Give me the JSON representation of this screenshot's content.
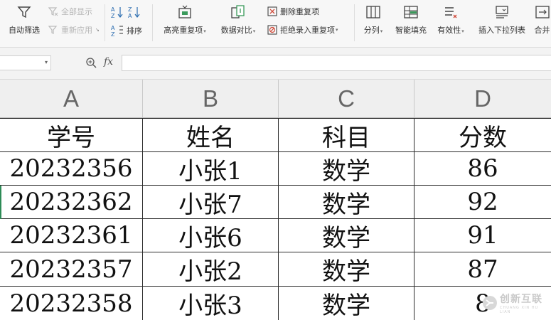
{
  "toolbar": {
    "filter_label": "自动筛选",
    "show_all_label": "全部显示",
    "reapply_label": "重新应用",
    "sort_label": "排序",
    "highlight_dup_label": "高亮重复项",
    "compare_label": "数据对比",
    "delete_dup_label": "删除重复项",
    "reject_dup_label": "拒绝录入重复项",
    "split_label": "分列",
    "smart_fill_label": "智能填充",
    "validity_label": "有效性",
    "dropdown_list_label": "插入下拉列表",
    "merge_label": "合并"
  },
  "formula_bar": {
    "fx_label": "fx",
    "formula_value": ""
  },
  "sheet": {
    "columns": [
      "A",
      "B",
      "C",
      "D"
    ],
    "rows": [
      [
        "学号",
        "姓名",
        "科目",
        "分数"
      ],
      [
        "20232356",
        "小张1",
        "数学",
        "86"
      ],
      [
        "20232362",
        "小张7",
        "数学",
        "92"
      ],
      [
        "20232361",
        "小张6",
        "数学",
        "91"
      ],
      [
        "20232357",
        "小张2",
        "数学",
        "87"
      ],
      [
        "20232358",
        "小张3",
        "数学",
        "8"
      ]
    ]
  },
  "watermark": {
    "text_cn": "创新互联",
    "text_en": "CHUANG XIN HU LIAN"
  },
  "colors": {
    "ribbon_bg": "#f7f7f7",
    "header_bg": "#efefef",
    "grid_line": "#2b2b2b",
    "active_row_marker": "#2e8b57"
  }
}
